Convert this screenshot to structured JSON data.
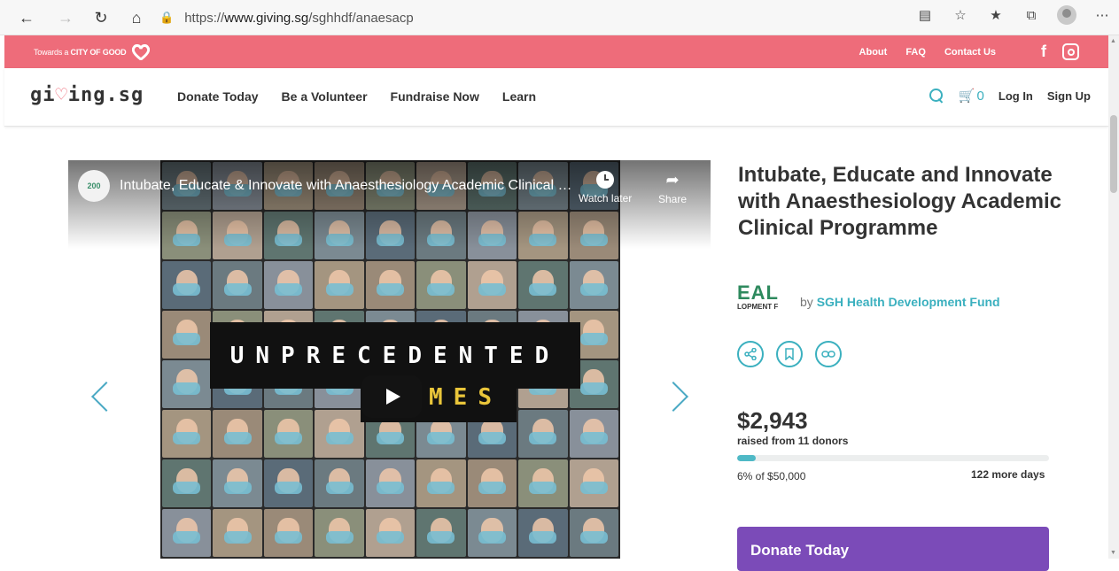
{
  "browser": {
    "url_prefix": "https://",
    "url_host": "www.giving.sg",
    "url_path": "/sghhdf/anaesacp"
  },
  "strip": {
    "tagline_prefix": "Towards a",
    "tagline_bold": "CITY OF GOOD",
    "links": [
      "About",
      "FAQ",
      "Contact Us"
    ],
    "facebook": "f"
  },
  "header": {
    "brand_a": "gi",
    "brand_heart": "♡",
    "brand_b": "ing.sg",
    "nav": [
      "Donate Today",
      "Be a Volunteer",
      "Fundraise Now",
      "Learn"
    ],
    "cart_count": "0",
    "login": "Log In",
    "signup": "Sign Up"
  },
  "video": {
    "channel_badge": "200",
    "title": "Intubate, Educate & Innovate with Anaesthesiology Academic Clinical Programme",
    "watch_later": "Watch later",
    "share": "Share",
    "banner_line1": "UNPRECEDENTED",
    "banner_line2": "MES"
  },
  "campaign": {
    "title": "Intubate, Educate and Innovate with Anaesthesiology Academic Clinical Programme",
    "org_logo_text": "EAL",
    "org_logo_sub": "LOPMENT F",
    "by": "by",
    "org_name": "SGH Health Development Fund",
    "amount": "$2,943",
    "raised_text": "raised from 11 donors",
    "progress_fraction": 0.06,
    "percent_text": "6% of $50,000",
    "days_left": "122 more days",
    "donate_label": "Donate Today"
  },
  "colors": {
    "strip_bg": "#ee6c7a",
    "accent": "#3bb0bf",
    "donate_bg": "#7b4bb8"
  }
}
